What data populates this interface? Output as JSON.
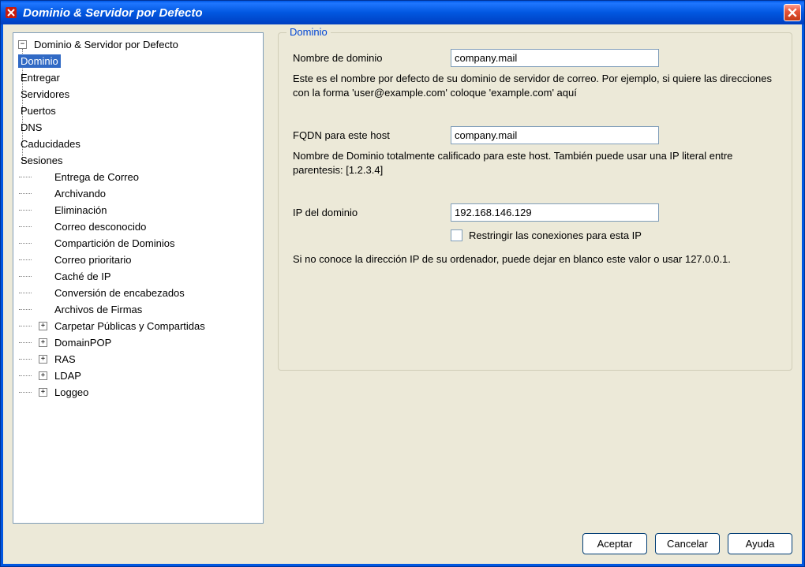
{
  "titlebar": {
    "title": "Dominio & Servidor por Defecto"
  },
  "tree": {
    "root": {
      "label": "Dominio & Servidor por Defecto",
      "expanded": true,
      "children": [
        {
          "label": "Dominio",
          "selected": true
        },
        {
          "label": "Entregar"
        },
        {
          "label": "Servidores"
        },
        {
          "label": "Puertos"
        },
        {
          "label": "DNS"
        },
        {
          "label": "Caducidades"
        },
        {
          "label": "Sesiones"
        }
      ]
    },
    "siblings": [
      {
        "label": "Entrega de Correo"
      },
      {
        "label": "Archivando"
      },
      {
        "label": "Eliminación"
      },
      {
        "label": "Correo desconocido"
      },
      {
        "label": "Compartición de Dominios"
      },
      {
        "label": "Correo prioritario"
      },
      {
        "label": "Caché de IP"
      },
      {
        "label": "Conversión de encabezados"
      },
      {
        "label": "Archivos de Firmas"
      }
    ],
    "collapsed": [
      {
        "label": "Carpetar Públicas y Compartidas"
      },
      {
        "label": "DomainPOP"
      },
      {
        "label": "RAS"
      },
      {
        "label": "LDAP"
      },
      {
        "label": "Loggeo"
      }
    ]
  },
  "group": {
    "title": "Dominio",
    "domain_label": "Nombre de dominio",
    "domain_value": "company.mail",
    "domain_help": "Este es el nombre por defecto de su dominio de servidor de correo. Por ejemplo, si quiere las direcciones con la forma 'user@example.com' coloque 'example.com' aquí",
    "fqdn_label": "FQDN para este host",
    "fqdn_value": "company.mail",
    "fqdn_help": "Nombre de Dominio totalmente calificado para este host. También puede usar una IP literal entre parentesis: [1.2.3.4]",
    "ip_label": "IP del dominio",
    "ip_value": "192.168.146.129",
    "restrict_label": "Restringir las conexiones para esta IP",
    "ip_help": "Si no conoce la dirección IP de su ordenador, puede dejar en blanco este valor o usar 127.0.0.1."
  },
  "buttons": {
    "ok": "Aceptar",
    "cancel": "Cancelar",
    "help": "Ayuda"
  }
}
